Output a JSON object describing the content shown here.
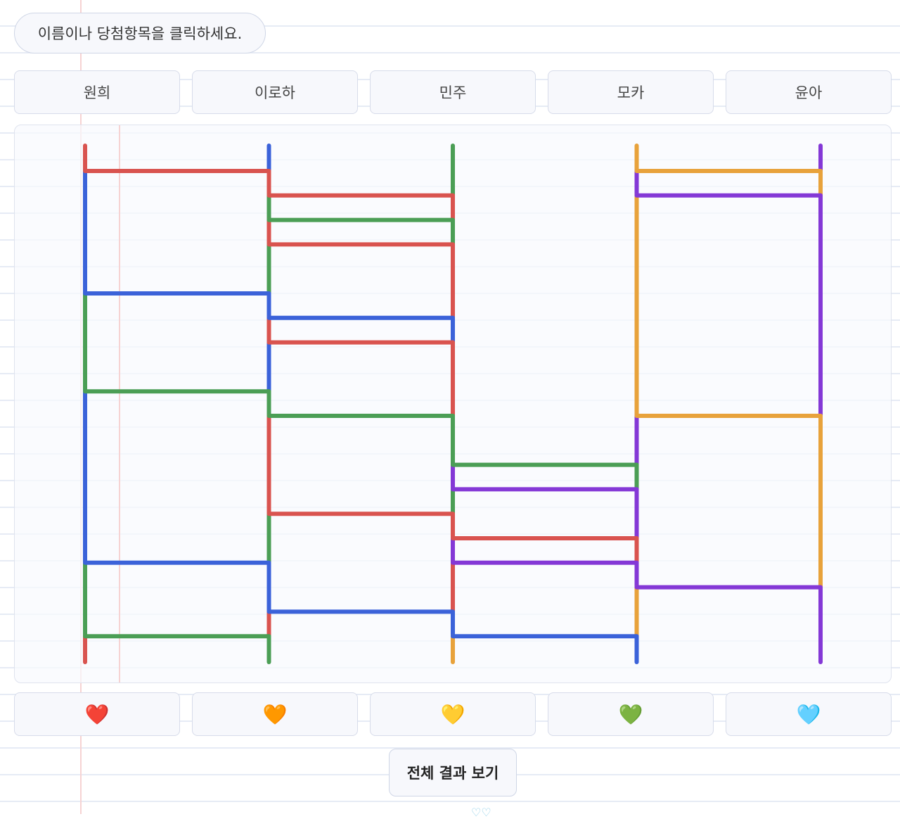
{
  "instruction": "이름이나 당첨항목을 클릭하세요.",
  "participants": [
    {
      "name": "원희",
      "color": "#d9534f"
    },
    {
      "name": "이로하",
      "color": "#3b62d9"
    },
    {
      "name": "민주",
      "color": "#4b9e55"
    },
    {
      "name": "모카",
      "color": "#e8a23b"
    },
    {
      "name": "윤아",
      "color": "#8438d6"
    }
  ],
  "prizes": [
    {
      "icon": "red-heart-icon",
      "glyph": "❤️"
    },
    {
      "icon": "orange-heart-icon",
      "glyph": "🧡"
    },
    {
      "icon": "yellow-heart-icon",
      "glyph": "💛"
    },
    {
      "icon": "green-heart-icon",
      "glyph": "💚"
    },
    {
      "icon": "light-blue-heart-icon",
      "glyph": "🩵"
    }
  ],
  "result_button_label": "전체 결과 보기",
  "ladder": {
    "levels": 20,
    "rungs": [
      {
        "left_column": 0,
        "level": 1
      },
      {
        "left_column": 3,
        "level": 1
      },
      {
        "left_column": 1,
        "level": 2
      },
      {
        "left_column": 3,
        "level": 2
      },
      {
        "left_column": 1,
        "level": 3
      },
      {
        "left_column": 1,
        "level": 4
      },
      {
        "left_column": 0,
        "level": 6
      },
      {
        "left_column": 1,
        "level": 7
      },
      {
        "left_column": 1,
        "level": 8
      },
      {
        "left_column": 0,
        "level": 10
      },
      {
        "left_column": 1,
        "level": 11
      },
      {
        "left_column": 3,
        "level": 11
      },
      {
        "left_column": 2,
        "level": 13
      },
      {
        "left_column": 2,
        "level": 14
      },
      {
        "left_column": 1,
        "level": 15
      },
      {
        "left_column": 2,
        "level": 16
      },
      {
        "left_column": 0,
        "level": 17
      },
      {
        "left_column": 2,
        "level": 17
      },
      {
        "left_column": 3,
        "level": 18
      },
      {
        "left_column": 1,
        "level": 19
      },
      {
        "left_column": 0,
        "level": 20
      },
      {
        "left_column": 2,
        "level": 20
      }
    ]
  }
}
